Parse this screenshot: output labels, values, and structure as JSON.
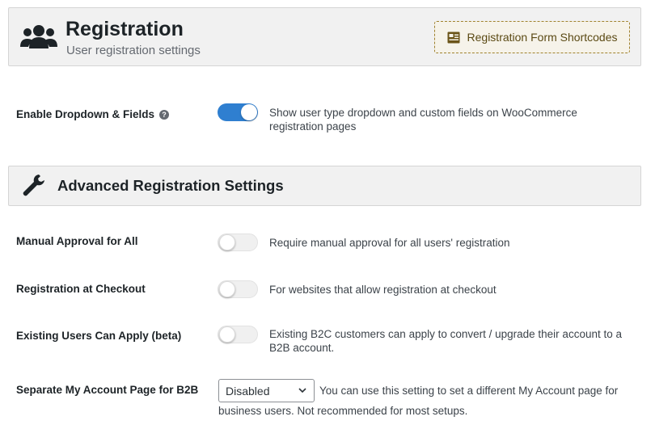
{
  "header": {
    "title": "Registration",
    "subtitle": "User registration settings",
    "shortcodes_button": "Registration Form Shortcodes",
    "icon": "users-icon"
  },
  "enable_dropdown": {
    "label": "Enable Dropdown & Fields",
    "help": "?",
    "enabled": true,
    "description_line1": "Show user type dropdown and custom fields on WooCommerce",
    "description_line2": "registration pages"
  },
  "advanced": {
    "title": "Advanced Registration Settings",
    "icon": "wrench-icon"
  },
  "settings": [
    {
      "label": "Manual Approval for All",
      "enabled": false,
      "description": "Require manual approval for all users' registration"
    },
    {
      "label": "Registration at Checkout",
      "enabled": false,
      "description": "For websites that allow registration at checkout"
    },
    {
      "label": "Existing Users Can Apply (beta)",
      "enabled": false,
      "description_line1": "Existing B2C customers can apply to convert / upgrade their account to a",
      "description_line2": "B2B account."
    }
  ],
  "separate_account": {
    "label": "Separate My Account Page for B2B",
    "selected": "Disabled",
    "description_line1": "You can use this setting to set a different My Account page for",
    "description_line2": "business users. Not recommended for most setups."
  },
  "colors": {
    "toggle_on": "#2f7fd0",
    "panel_bg": "#f1f1f1",
    "button_border": "#a0822e"
  }
}
